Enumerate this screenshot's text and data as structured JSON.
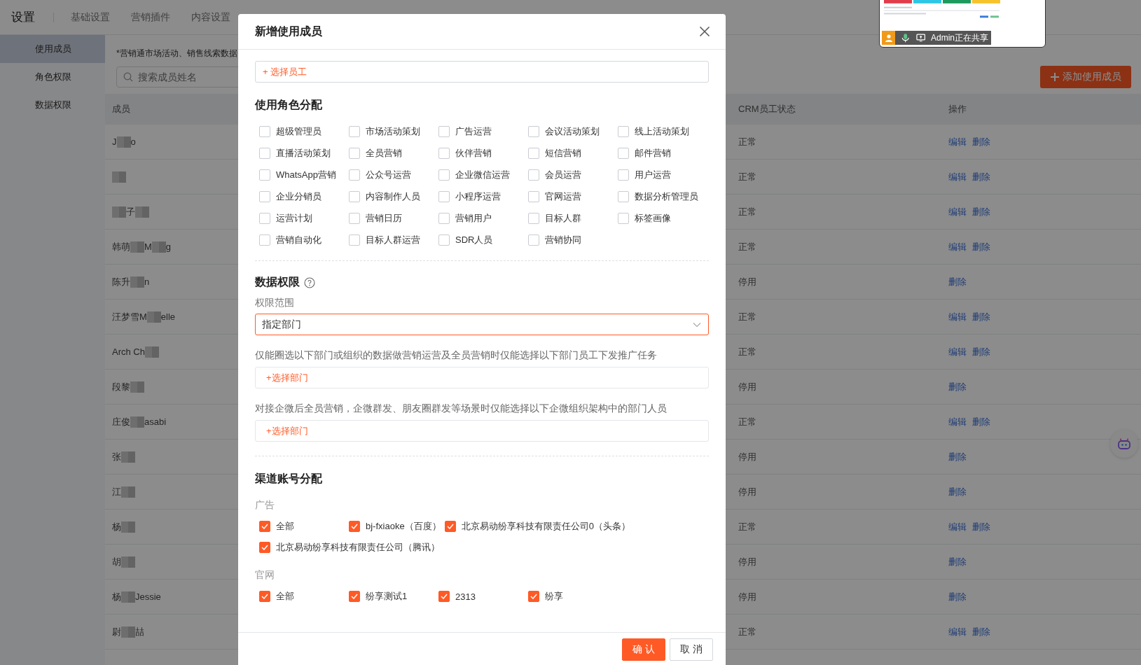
{
  "top_nav": {
    "title": "设置",
    "tabs": [
      {
        "label": "基础设置"
      },
      {
        "label": "营销插件"
      },
      {
        "label": "内容设置"
      }
    ]
  },
  "sidebar": {
    "items": [
      {
        "label": "使用成员",
        "selected": true
      },
      {
        "label": "角色权限",
        "selected": false
      },
      {
        "label": "数据权限",
        "selected": false
      }
    ]
  },
  "notice": "*营销通市场活动、销售线索数据",
  "search": {
    "placeholder": "搜索成员姓名"
  },
  "add_button": "添加使用成员",
  "table": {
    "columns": [
      "成员",
      "CRM员工状态",
      "操作"
    ],
    "rows": [
      {
        "segments": [
          {
            "kind": "text",
            "text": "J"
          },
          {
            "kind": "blur"
          },
          {
            "kind": "text",
            "text": "o"
          }
        ],
        "status": "正常",
        "actions": [
          "编辑",
          "删除"
        ]
      },
      {
        "segments": [
          {
            "kind": "blur"
          }
        ],
        "status": "正常",
        "actions": [
          "编辑",
          "删除"
        ]
      },
      {
        "segments": [
          {
            "kind": "blur"
          },
          {
            "kind": "text",
            "text": "子"
          },
          {
            "kind": "blur"
          }
        ],
        "status": "正常",
        "actions": [
          "编辑",
          "删除"
        ]
      },
      {
        "segments": [
          {
            "kind": "text",
            "text": "韩萌"
          },
          {
            "kind": "blur"
          },
          {
            "kind": "text",
            "text": "M"
          },
          {
            "kind": "blur"
          },
          {
            "kind": "text",
            "text": "g"
          }
        ],
        "status": "正常",
        "actions": [
          "编辑",
          "删除"
        ]
      },
      {
        "segments": [
          {
            "kind": "text",
            "text": "陈升"
          },
          {
            "kind": "blur"
          },
          {
            "kind": "text",
            "text": "n"
          }
        ],
        "status": "停用",
        "actions": [
          "删除"
        ]
      },
      {
        "segments": [
          {
            "kind": "text",
            "text": "汪梦雪M"
          },
          {
            "kind": "blur"
          },
          {
            "kind": "text",
            "text": "elle"
          }
        ],
        "status": "正常",
        "actions": [
          "编辑",
          "删除"
        ]
      },
      {
        "segments": [
          {
            "kind": "text",
            "text": "Arch Ch"
          },
          {
            "kind": "blur"
          }
        ],
        "status": "正常",
        "actions": [
          "编辑",
          "删除"
        ]
      },
      {
        "segments": [
          {
            "kind": "text",
            "text": "段黎"
          },
          {
            "kind": "blur"
          }
        ],
        "status": "停用",
        "actions": [
          "删除"
        ]
      },
      {
        "segments": [
          {
            "kind": "text",
            "text": "庄俊"
          },
          {
            "kind": "blur"
          },
          {
            "kind": "text",
            "text": "asabi"
          }
        ],
        "status": "正常",
        "actions": [
          "编辑",
          "删除"
        ]
      },
      {
        "segments": [
          {
            "kind": "text",
            "text": "张"
          },
          {
            "kind": "blur"
          }
        ],
        "status": "停用",
        "actions": [
          "删除"
        ]
      },
      {
        "segments": [
          {
            "kind": "text",
            "text": "江"
          },
          {
            "kind": "blur"
          }
        ],
        "status": "停用",
        "actions": [
          "删除"
        ]
      },
      {
        "segments": [
          {
            "kind": "text",
            "text": "杨"
          },
          {
            "kind": "blur"
          }
        ],
        "status": "正常",
        "actions": [
          "编辑",
          "删除"
        ]
      },
      {
        "segments": [
          {
            "kind": "text",
            "text": "胡"
          },
          {
            "kind": "blur"
          }
        ],
        "status": "停用",
        "actions": [
          "删除"
        ]
      },
      {
        "segments": [
          {
            "kind": "text",
            "text": "杨"
          },
          {
            "kind": "blur"
          },
          {
            "kind": "text",
            "text": "Jessie"
          }
        ],
        "status": "停用",
        "actions": [
          "删除"
        ]
      },
      {
        "segments": [
          {
            "kind": "text",
            "text": "尉"
          },
          {
            "kind": "blur"
          },
          {
            "kind": "text",
            "text": "喆"
          }
        ],
        "status": "正常",
        "actions": [
          "编辑",
          "删除"
        ]
      }
    ]
  },
  "screen_share": {
    "label": "Admin正在共享"
  },
  "dialog": {
    "title": "新增使用成员",
    "employee_picker": "+ 选择员工",
    "roles": {
      "title": "使用角色分配",
      "options": [
        {
          "label": "超级管理员",
          "checked": false
        },
        {
          "label": "市场活动策划",
          "checked": false
        },
        {
          "label": "广告运营",
          "checked": false
        },
        {
          "label": "会议活动策划",
          "checked": false
        },
        {
          "label": "线上活动策划",
          "checked": false
        },
        {
          "label": "直播活动策划",
          "checked": false
        },
        {
          "label": "全员营销",
          "checked": false
        },
        {
          "label": "伙伴营销",
          "checked": false
        },
        {
          "label": "短信营销",
          "checked": false
        },
        {
          "label": "邮件营销",
          "checked": false
        },
        {
          "label": "WhatsApp营销",
          "checked": false
        },
        {
          "label": "公众号运营",
          "checked": false
        },
        {
          "label": "企业微信运营",
          "checked": false
        },
        {
          "label": "会员运营",
          "checked": false
        },
        {
          "label": "用户运营",
          "checked": false
        },
        {
          "label": "企业分销员",
          "checked": false
        },
        {
          "label": "内容制作人员",
          "checked": false
        },
        {
          "label": "小程序运营",
          "checked": false
        },
        {
          "label": "官网运营",
          "checked": false
        },
        {
          "label": "数据分析管理员",
          "checked": false
        },
        {
          "label": "运营计划",
          "checked": false
        },
        {
          "label": "营销日历",
          "checked": false
        },
        {
          "label": "营销用户",
          "checked": false
        },
        {
          "label": "目标人群",
          "checked": false
        },
        {
          "label": "标签画像",
          "checked": false
        },
        {
          "label": "营销自动化",
          "checked": false
        },
        {
          "label": "目标人群运营",
          "checked": false
        },
        {
          "label": "SDR人员",
          "checked": false
        },
        {
          "label": "营销协同",
          "checked": false
        }
      ]
    },
    "data_permission": {
      "title": "数据权限",
      "scope_label": "权限范围",
      "scope_value": "指定部门",
      "fields": [
        {
          "description": "仅能圈选以下部门或组织的数据做营销运营及全员营销时仅能选择以下部门员工下发推广任务",
          "picker": "+选择部门"
        },
        {
          "description": "对接企微后全员营销，企微群发、朋友圈群发等场景时仅能选择以下企微组织架构中的部门人员",
          "picker": "+选择部门"
        }
      ]
    },
    "channels": {
      "title": "渠道账号分配",
      "groups": [
        {
          "name": "广告",
          "options": [
            {
              "label": "全部",
              "checked": true
            },
            {
              "label": "bj-fxiaoke（百度）",
              "checked": true
            },
            {
              "label": "北京易动纷享科技有限责任公司0（头条）",
              "checked": true
            },
            {
              "label": "北京易动纷享科技有限责任公司（腾讯）",
              "checked": true
            }
          ]
        },
        {
          "name": "官网",
          "options": [
            {
              "label": "全部",
              "checked": true
            },
            {
              "label": "纷享测试1",
              "checked": true
            },
            {
              "label": "2313",
              "checked": true
            },
            {
              "label": "纷享",
              "checked": true
            }
          ]
        }
      ]
    },
    "buttons": [
      {
        "label": "确 认",
        "kind": "primary"
      },
      {
        "label": "取 消",
        "kind": "default"
      }
    ]
  }
}
